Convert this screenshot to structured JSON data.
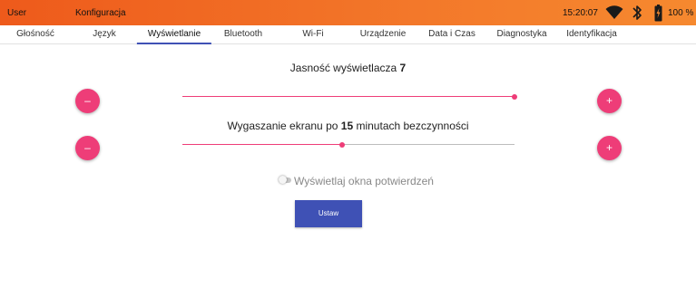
{
  "statusbar": {
    "user": "User",
    "section": "Konfiguracja",
    "time": "15:20:07",
    "battery": "100 %",
    "icons": [
      "wifi-icon",
      "bluetooth-icon",
      "battery-icon"
    ]
  },
  "tabs": [
    {
      "label": "Głośność",
      "active": false
    },
    {
      "label": "Język",
      "active": false
    },
    {
      "label": "Wyświetlanie",
      "active": true
    },
    {
      "label": "Bluetooth",
      "active": false
    },
    {
      "label": "Wi-Fi",
      "active": false
    },
    {
      "label": "Urządzenie",
      "active": false
    },
    {
      "label": "Data i Czas",
      "active": false
    },
    {
      "label": "Diagnostyka",
      "active": false
    },
    {
      "label": "Identyfikacja",
      "active": false
    }
  ],
  "brightness": {
    "label": "Jasność wyświetlacza",
    "value": "7",
    "level": 1.0,
    "minus": "–",
    "plus": "+"
  },
  "timeout": {
    "label_before": "Wygaszanie ekranu po",
    "value": "15",
    "label_after": "minutach bezczynności",
    "level": 0.48,
    "minus": "–",
    "plus": "+"
  },
  "confirm_toggle": {
    "label": "Wyświetlaj okna potwierdzeń",
    "enabled": false
  },
  "set_button": "Ustaw",
  "colors": {
    "accent": "#ee3d78",
    "primary": "#3f51b5",
    "header": "#f3782a"
  }
}
